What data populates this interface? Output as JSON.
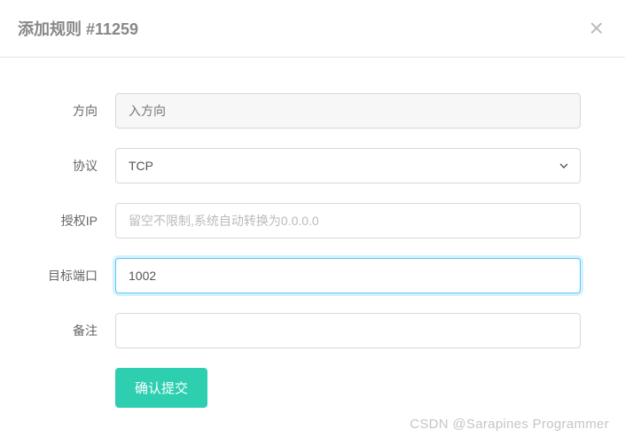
{
  "header": {
    "title": "添加规则 #11259"
  },
  "form": {
    "direction": {
      "label": "方向",
      "value": "入方向"
    },
    "protocol": {
      "label": "协议",
      "value": "TCP"
    },
    "authorized_ip": {
      "label": "授权IP",
      "value": "",
      "placeholder": "留空不限制,系统自动转换为0.0.0.0"
    },
    "target_port": {
      "label": "目标端口",
      "value": "1002"
    },
    "remark": {
      "label": "备注",
      "value": ""
    },
    "submit_label": "确认提交"
  },
  "watermark": "CSDN @Sarapines Programmer"
}
